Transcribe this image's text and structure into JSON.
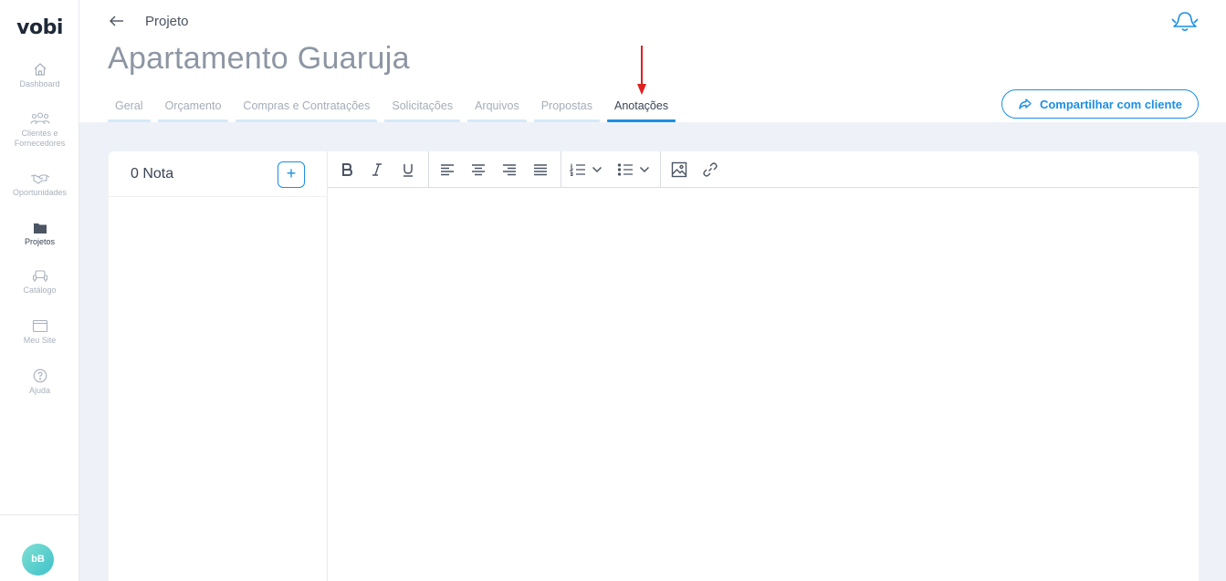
{
  "app": {
    "logo": "vobi"
  },
  "sidebar": {
    "items": [
      {
        "label": "Dashboard",
        "icon": "home-icon",
        "active": false
      },
      {
        "label": "Clientes e Fornecedores",
        "icon": "users-icon",
        "active": false
      },
      {
        "label": "Oportunidades",
        "icon": "handshake-icon",
        "active": false
      },
      {
        "label": "Projetos",
        "icon": "folder-icon",
        "active": true
      },
      {
        "label": "Catálogo",
        "icon": "sofa-icon",
        "active": false
      },
      {
        "label": "Meu Site",
        "icon": "browser-icon",
        "active": false
      },
      {
        "label": "Ajuda",
        "icon": "help-icon",
        "active": false
      }
    ],
    "avatar": "bB"
  },
  "header": {
    "breadcrumb": "Projeto",
    "title": "Apartamento Guaruja",
    "tabs": [
      {
        "label": "Geral",
        "active": false
      },
      {
        "label": "Orçamento",
        "active": false
      },
      {
        "label": "Compras e Contratações",
        "active": false
      },
      {
        "label": "Solicitações",
        "active": false
      },
      {
        "label": "Arquivos",
        "active": false
      },
      {
        "label": "Propostas",
        "active": false
      },
      {
        "label": "Anotações",
        "active": true
      }
    ],
    "share_button": "Compartilhar com cliente"
  },
  "notes": {
    "count_label": "0 Nota",
    "add_label": "+"
  },
  "editor": {
    "toolbar": [
      "bold",
      "italic",
      "underline",
      "align-left",
      "align-center",
      "align-right",
      "align-justify",
      "ordered-list",
      "bullet-list",
      "image",
      "link"
    ]
  },
  "colors": {
    "accent": "#1b8fe4",
    "content_background": "#eef2f8",
    "annotation_arrow": "#e02020"
  }
}
